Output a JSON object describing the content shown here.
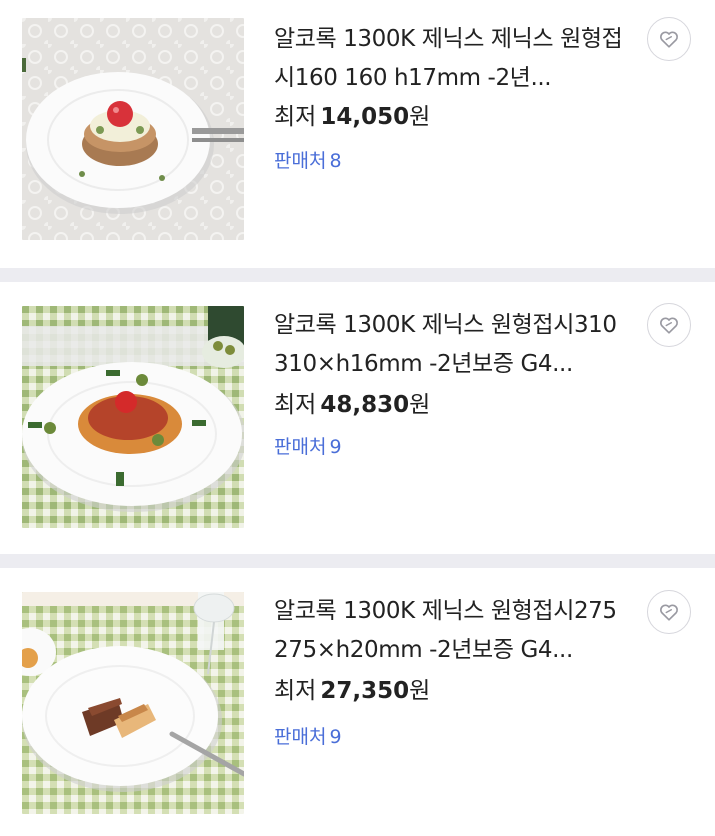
{
  "products": [
    {
      "title": "알코록 1300K 제닉스 제닉스 원형접시160 160 h17mm -2년...",
      "price_prefix": "최저",
      "price_amount": "14,050",
      "price_unit": "원",
      "sellers_label": "판매처",
      "sellers_count": "8",
      "image": "plate-with-cake"
    },
    {
      "title": "알코록 1300K 제닉스 원형접시310 310×h16mm -2년보증 G4...",
      "price_prefix": "최저",
      "price_amount": "48,830",
      "price_unit": "원",
      "sellers_label": "판매처",
      "sellers_count": "9",
      "image": "plate-with-spaghetti"
    },
    {
      "title": "알코록 1300K 제닉스 원형접시275 275×h20mm -2년보증 G4...",
      "price_prefix": "최저",
      "price_amount": "27,350",
      "price_unit": "원",
      "sellers_label": "판매처",
      "sellers_count": "9",
      "image": "plate-with-dessert-bars"
    }
  ],
  "icons": {
    "favorite": "heart-outline-icon"
  },
  "colors": {
    "sellers_link": "#4a6ed8",
    "separator": "#ececf1",
    "heart_stroke": "#9a9aa2"
  }
}
